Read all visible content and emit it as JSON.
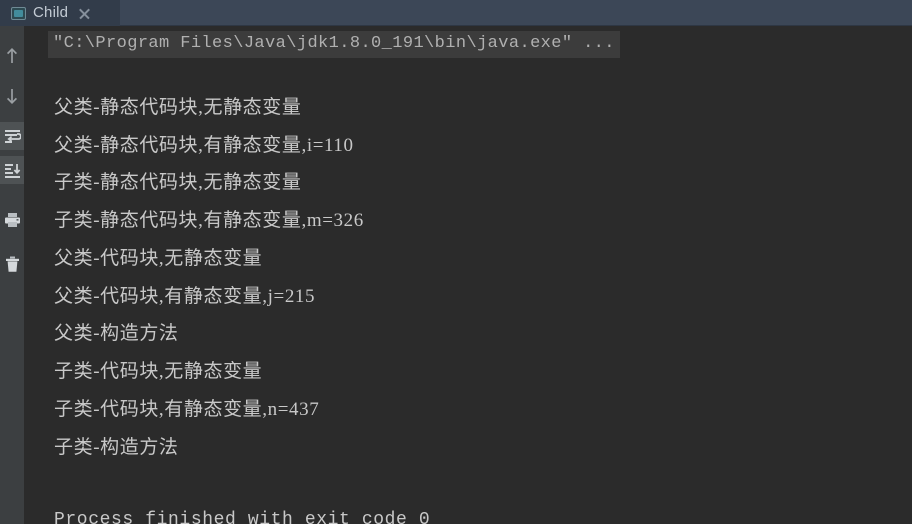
{
  "tab": {
    "label": "Child",
    "icon": "console-window-icon",
    "close_icon": "close-icon"
  },
  "toolbar": {
    "buttons": [
      {
        "name": "up-arrow-icon",
        "label": "Up the Stack Trace",
        "active": false
      },
      {
        "name": "down-arrow-icon",
        "label": "Down the Stack Trace",
        "active": false
      },
      {
        "name": "soft-wrap-icon",
        "label": "Soft-Wrap",
        "active": true
      },
      {
        "name": "scroll-to-end-icon",
        "label": "Scroll to the end",
        "active": true
      },
      {
        "name": "print-icon",
        "label": "Print",
        "active": false
      },
      {
        "name": "trash-icon",
        "label": "Clear All",
        "active": false
      }
    ]
  },
  "console": {
    "command_line": "\"C:\\Program Files\\Java\\jdk1.8.0_191\\bin\\java.exe\" ...",
    "output_lines": [
      "父类-静态代码块,无静态变量",
      "父类-静态代码块,有静态变量,i=110",
      "子类-静态代码块,无静态变量",
      "子类-静态代码块,有静态变量,m=326",
      "父类-代码块,无静态变量",
      "父类-代码块,有静态变量,j=215",
      "父类-构造方法",
      "子类-代码块,无静态变量",
      "子类-代码块,有静态变量,n=437",
      "子类-构造方法"
    ],
    "exit_message": "Process finished with exit code 0"
  },
  "colors": {
    "tabbar_bg": "#3c4757",
    "tab_selected_bg": "#323c4a",
    "toolbar_bg": "#3c3f41",
    "console_bg": "#2b2b2b",
    "text": "#c8c8c8",
    "command_bg": "#3c3c3c",
    "tab_icon_accent": "#4aa3b5"
  }
}
